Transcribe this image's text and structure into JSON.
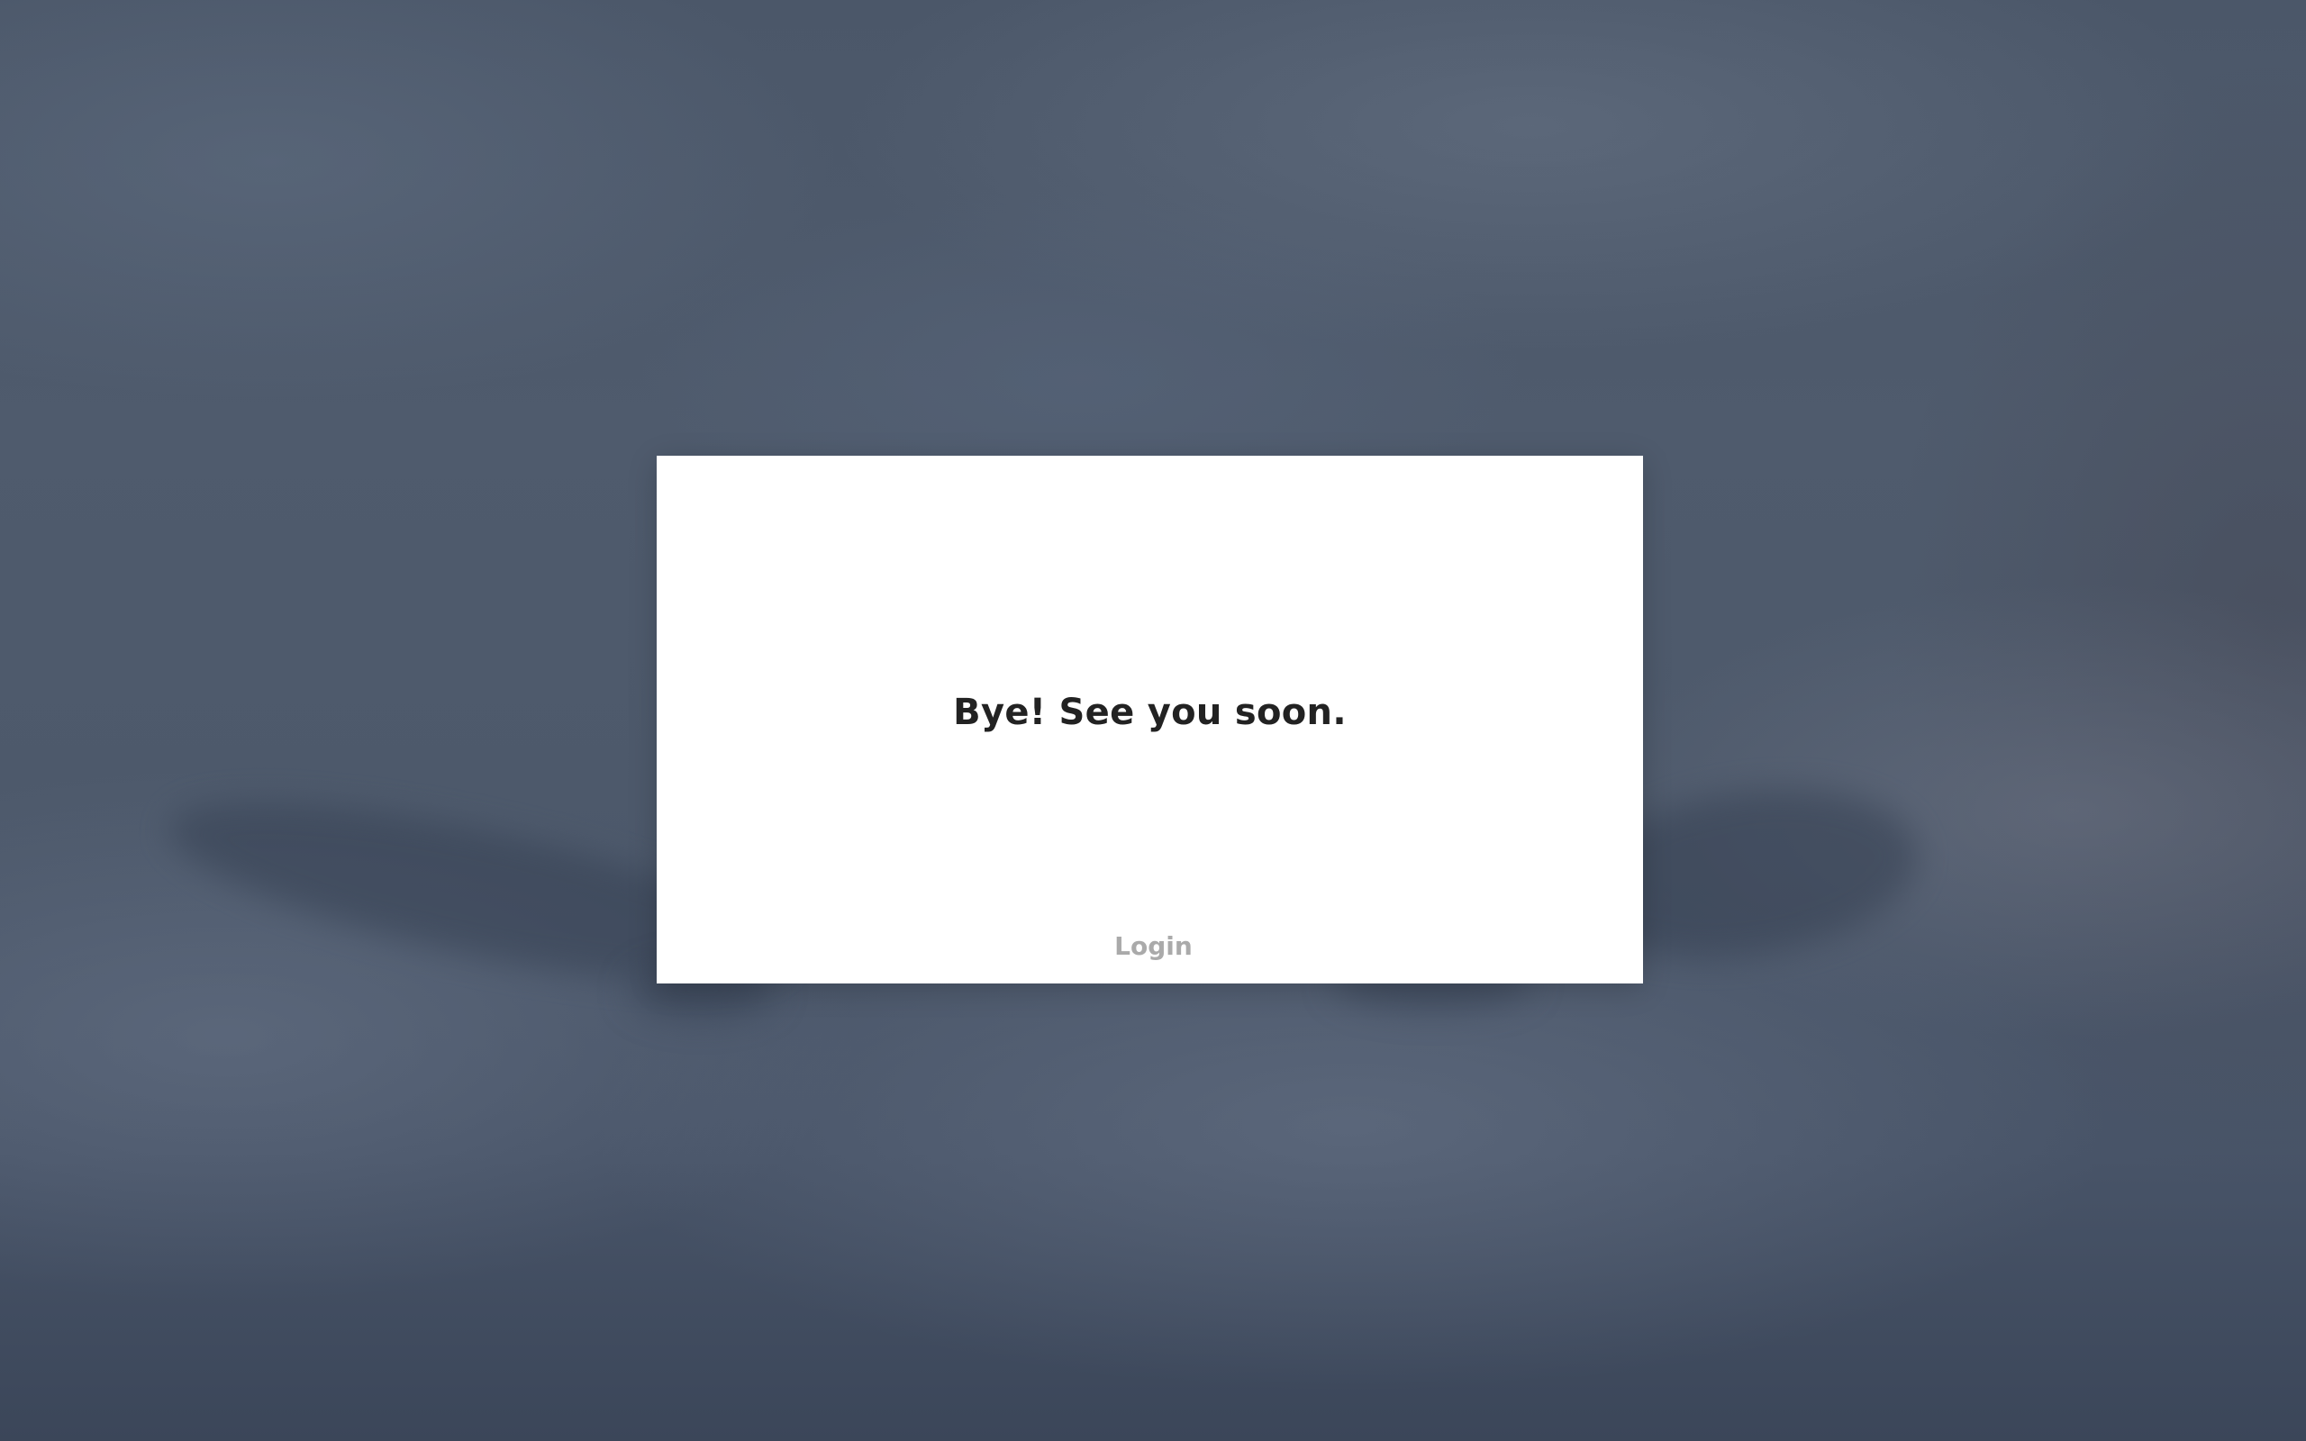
{
  "dialog": {
    "message": "Bye! See you soon.",
    "login_label": "Login"
  },
  "colors": {
    "message_text": "#222222",
    "login_text": "#aaaaaa",
    "dialog_background": "#ffffff",
    "page_background": "#4a5668"
  }
}
